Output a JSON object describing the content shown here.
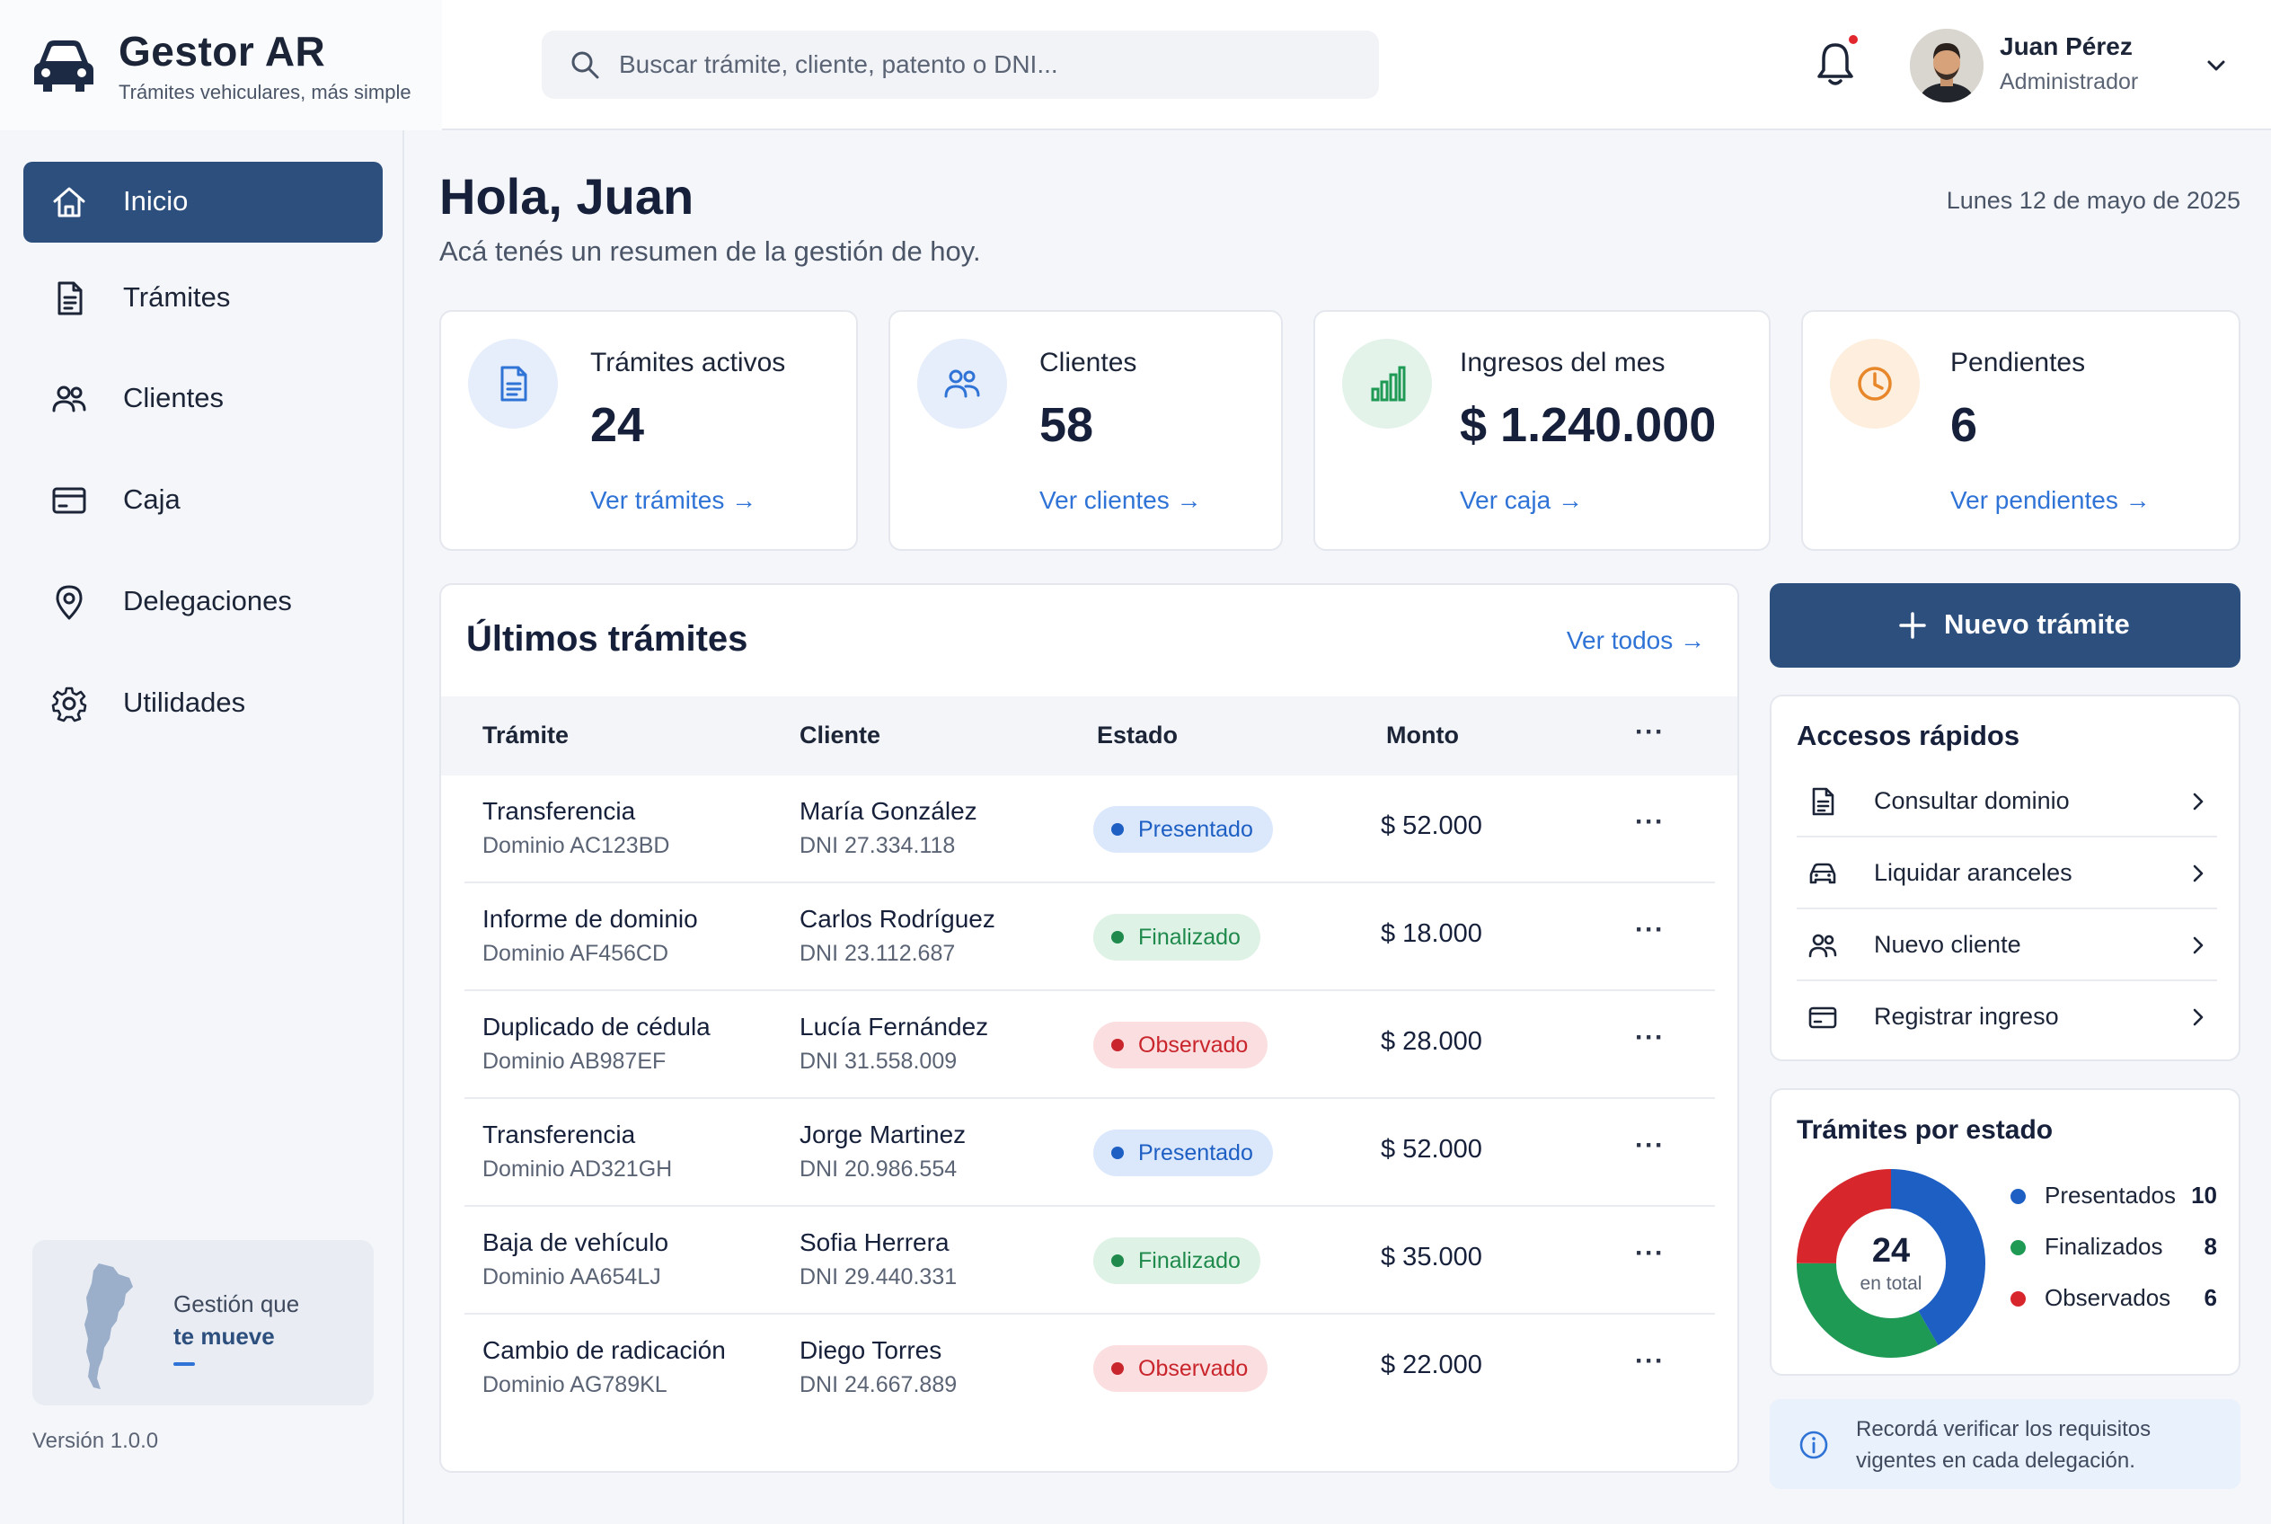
{
  "brand": {
    "name": "Gestor AR",
    "tagline": "Trámites vehiculares, más simple"
  },
  "search": {
    "placeholder": "Buscar trámite, cliente, patento o DNI..."
  },
  "user": {
    "name": "Juan Pérez",
    "role": "Administrador"
  },
  "sidebar": {
    "items": [
      {
        "label": "Inicio",
        "icon": "home-icon",
        "active": true
      },
      {
        "label": "Trámites",
        "icon": "document-icon"
      },
      {
        "label": "Clientes",
        "icon": "users-icon"
      },
      {
        "label": "Caja",
        "icon": "card-icon"
      },
      {
        "label": "Delegaciones",
        "icon": "map-pin-icon"
      },
      {
        "label": "Utilidades",
        "icon": "gear-icon"
      }
    ],
    "promo": {
      "line1": "Gestión que",
      "line2": "te mueve"
    },
    "version": "Versión 1.0.0"
  },
  "main": {
    "greeting": "Hola, Juan",
    "subtitle": "Acá tenés un resumen de la gestión de hoy.",
    "date": "Lunes 12 de mayo de 2025"
  },
  "stats": [
    {
      "label": "Trámites activos",
      "value": "24",
      "link": "Ver trámites →",
      "icon": "document-icon",
      "color": "#2f73d6"
    },
    {
      "label": "Clientes",
      "value": "58",
      "link": "Ver clientes →",
      "icon": "users-icon",
      "color": "#2f73d6"
    },
    {
      "label": "Ingresos del mes",
      "value": "$ 1.240.000",
      "link": "Ver caja →",
      "icon": "bar-chart-icon",
      "color": "#1f9a55"
    },
    {
      "label": "Pendientes",
      "value": "6",
      "link": "Ver pendientes →",
      "icon": "clock-icon",
      "color": "#e8862a"
    }
  ],
  "table": {
    "title": "Últimos trámites",
    "link": "Ver todos →",
    "columns": [
      "Trámite",
      "Cliente",
      "Estado",
      "Monto"
    ],
    "more": "···",
    "rows": [
      {
        "tramite": "Transferencia",
        "dominio": "Dominio AC123BD",
        "cliente": "María González",
        "dni": "DNI 27.334.118",
        "estado": "Presentado",
        "monto": "$ 52.000"
      },
      {
        "tramite": "Informe de dominio",
        "dominio": "Dominio AF456CD",
        "cliente": "Carlos Rodríguez",
        "dni": "DNI 23.112.687",
        "estado": "Finalizado",
        "monto": "$ 18.000"
      },
      {
        "tramite": "Duplicado de cédula",
        "dominio": "Dominio AB987EF",
        "cliente": "Lucía Fernández",
        "dni": "DNI 31.558.009",
        "estado": "Observado",
        "monto": "$ 28.000"
      },
      {
        "tramite": "Transferencia",
        "dominio": "Dominio AD321GH",
        "cliente": "Jorge Martinez",
        "dni": "DNI 20.986.554",
        "estado": "Presentado",
        "monto": "$ 52.000"
      },
      {
        "tramite": "Baja de vehículo",
        "dominio": "Dominio AA654LJ",
        "cliente": "Sofia Herrera",
        "dni": "DNI 29.440.331",
        "estado": "Finalizado",
        "monto": "$ 35.000"
      },
      {
        "tramite": "Cambio de radicación",
        "dominio": "Dominio AG789KL",
        "cliente": "Diego Torres",
        "dni": "DNI 24.667.889",
        "estado": "Observado",
        "monto": "$ 22.000"
      }
    ]
  },
  "new_button": {
    "label": "Nuevo trámite"
  },
  "quick_access": {
    "title": "Accesos rápidos",
    "items": [
      {
        "label": "Consultar dominio",
        "icon": "document-icon"
      },
      {
        "label": "Liquidar aranceles",
        "icon": "car-icon"
      },
      {
        "label": "Nuevo cliente",
        "icon": "users-icon"
      },
      {
        "label": "Registrar ingreso",
        "icon": "card-icon"
      }
    ]
  },
  "status_summary": {
    "title": "Trámites por estado",
    "total": "24",
    "total_label": "en total",
    "items": [
      {
        "label": "Presentados",
        "value": "10",
        "color": "#1e5fc4"
      },
      {
        "label": "Finalizados",
        "value": "8",
        "color": "#1f9a55"
      },
      {
        "label": "Observados",
        "value": "6",
        "color": "#d8262d"
      }
    ]
  },
  "notice": {
    "text": "Recordá verificar los requisitos vigentes en cada delegación."
  },
  "colors": {
    "primary": "#2d4f7e",
    "accent": "#2f73d6"
  }
}
